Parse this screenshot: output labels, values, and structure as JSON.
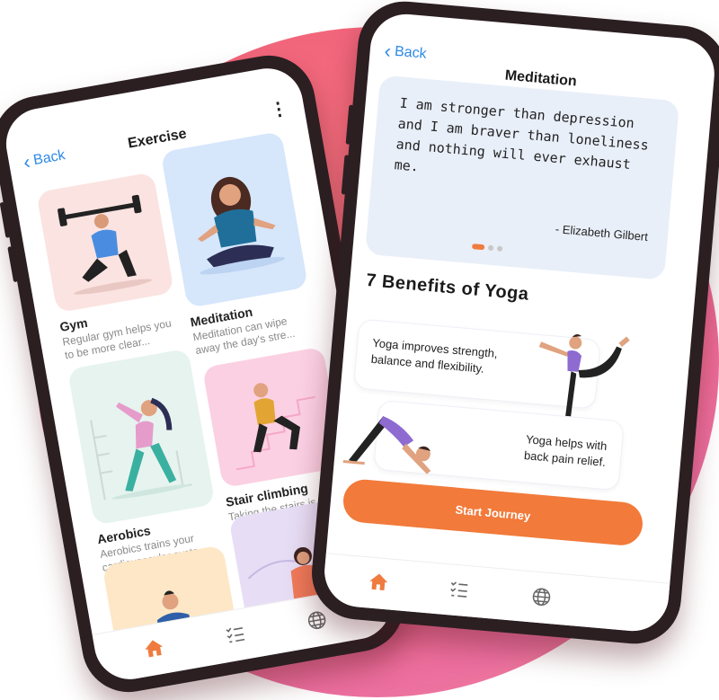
{
  "colors": {
    "accent": "#f27a3a",
    "link": "#2e89e6",
    "background_blob": "#f0607a"
  },
  "exercise_screen": {
    "back_label": "Back",
    "title": "Exercise",
    "cards": [
      {
        "name": "Gym",
        "desc": "Regular gym helps you to be more clear..."
      },
      {
        "name": "Meditation",
        "desc": "Meditation can wipe away the day's stre..."
      },
      {
        "name": "Aerobics",
        "desc": "Aerobics trains your cardiovascular syste..."
      },
      {
        "name": "Stair climbing",
        "desc": "Taking the stairs is an easily available type..."
      }
    ],
    "tabs": [
      {
        "icon": "home-icon",
        "active": true
      },
      {
        "icon": "checklist-icon",
        "active": false
      },
      {
        "icon": "globe-icon",
        "active": false
      }
    ]
  },
  "meditation_screen": {
    "back_label": "Back",
    "title": "Meditation",
    "quote": {
      "text": "I am stronger than depression and I am braver than loneliness and nothing will ever exhaust me.",
      "author": "- Elizabeth Gilbert"
    },
    "section_title": "7 Benefits of Yoga",
    "benefits": [
      "Yoga improves strength, balance and flexibility.",
      "Yoga helps with back pain relief."
    ],
    "cta_label": "Start Journey"
  }
}
